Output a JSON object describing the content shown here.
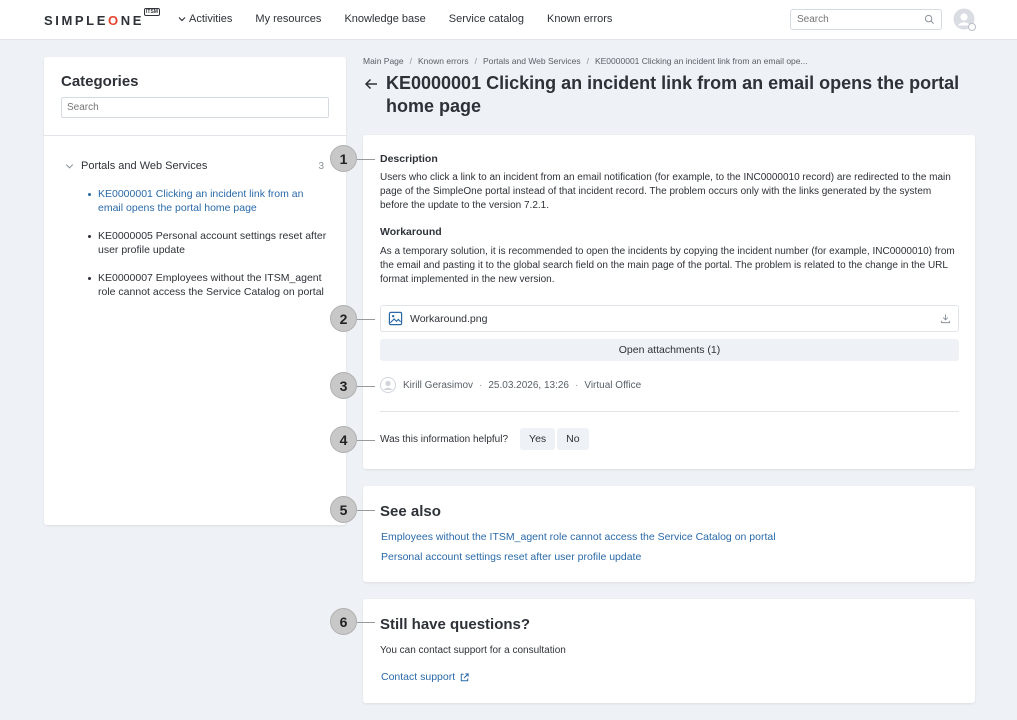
{
  "header": {
    "logo": {
      "pre": "SIMPLE",
      "o": "O",
      "post": "NE",
      "badge": "ITSM"
    },
    "nav": [
      "Activities",
      "My resources",
      "Knowledge base",
      "Service catalog",
      "Known errors"
    ],
    "search_placeholder": "Search"
  },
  "sidebar": {
    "title": "Categories",
    "search_placeholder": "Search",
    "group": {
      "label": "Portals and Web Services",
      "count": "3"
    },
    "items": [
      {
        "label": "KE0000001 Clicking an incident link from an email opens the portal home page",
        "active": true
      },
      {
        "label": "KE0000005 Personal account settings reset after user profile update",
        "active": false
      },
      {
        "label": "KE0000007 Employees without the ITSM_agent role cannot access the Service Catalog on portal",
        "active": false
      }
    ]
  },
  "breadcrumb": [
    "Main Page",
    "Known errors",
    "Portals and Web Services",
    "KE0000001 Clicking an incident link from an email ope..."
  ],
  "article": {
    "title": "KE0000001 Clicking an incident link from an email opens the portal home page",
    "description_heading": "Description",
    "description": "Users who click a link to an incident from an email notification (for example, to the INC0000010 record) are redirected to the main page of the SimpleOne portal instead of that incident record. The problem occurs only with the links generated by the system before the update to the version 7.2.1.",
    "workaround_heading": "Workaround",
    "workaround": "As a temporary solution, it is recommended to open the incidents by copying the incident number (for example, INC0000010) from the email and pasting it to the global search field on the main page of the portal. The problem is related to the change in the URL format implemented in the new version.",
    "attachment": "Workaround.png",
    "open_attachments": "Open attachments (1)",
    "author": "Kirill Gerasimov",
    "date": "25.03.2026, 13:26",
    "location": "Virtual Office",
    "helpful_question": "Was this information helpful?",
    "yes": "Yes",
    "no": "No"
  },
  "see_also": {
    "title": "See also",
    "links": [
      "Employees without the ITSM_agent role cannot access the Service Catalog on portal",
      "Personal account settings reset after user profile update"
    ]
  },
  "questions": {
    "title": "Still have questions?",
    "text": "You can contact support for a consultation",
    "link": "Contact support"
  },
  "markers": [
    "1",
    "2",
    "3",
    "4",
    "5",
    "6"
  ],
  "colors": {
    "accent": "#2a6aa8",
    "logo_o": "#e4442b",
    "background": "#eef1f5"
  }
}
